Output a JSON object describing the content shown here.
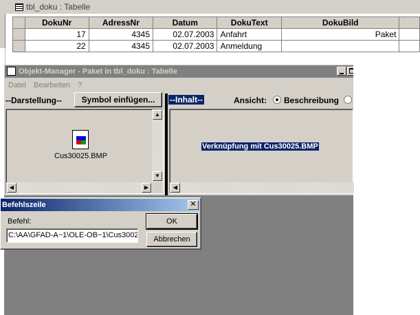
{
  "table_window": {
    "title": "tbl_doku : Tabelle",
    "columns": [
      "DokuNr",
      "AdressNr",
      "Datum",
      "DokuText",
      "DokuBild"
    ],
    "rows": [
      [
        "17",
        "4345",
        "02.07.2003",
        "Anfahrt",
        "Paket"
      ],
      [
        "22",
        "4345",
        "02.07.2003",
        "Anmeldung",
        ""
      ]
    ]
  },
  "object_manager": {
    "title": "Objekt-Manager - Paket in tbl_doku : Tabelle",
    "menu": [
      "Datei",
      "Bearbeiten",
      "?"
    ],
    "darstellung_label": "--Darstellung--",
    "insert_symbol_button": "Symbol einfügen...",
    "inhalt_label": "--Inhalt--",
    "ansicht_label": "Ansicht:",
    "view_option_beschreibung": "Beschreibung",
    "icon_caption": "Cus30025.BMP",
    "content_text": "Verknüpfung mit Cus30025.BMP"
  },
  "command_dialog": {
    "title": "Befehlszeile",
    "befehl_label": "Befehl:",
    "befehl_value": "C:\\AA\\GFAD-A~1\\OLE-OB~1\\Cus3002",
    "ok_button": "OK",
    "cancel_button": "Abbrechen"
  },
  "colors": {
    "title_active": "#0a246a",
    "title_inactive": "#808080",
    "face": "#d4d0c8",
    "desktop": "#808080"
  }
}
